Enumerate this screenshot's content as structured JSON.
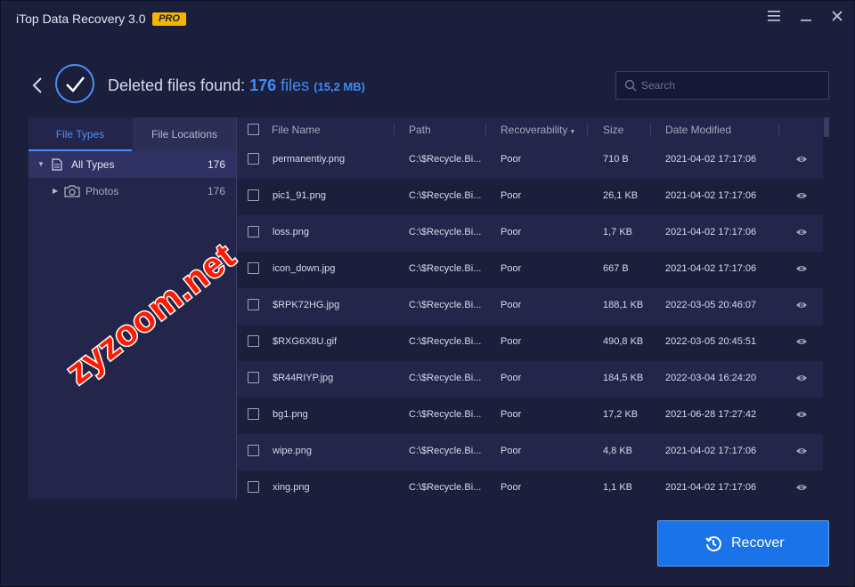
{
  "window": {
    "title": "iTop Data Recovery 3.0",
    "badge": "PRO",
    "menu_icon": "hamburger-menu-icon",
    "minimize_icon": "minimize-icon",
    "close_icon": "close-icon"
  },
  "header": {
    "prefix": "Deleted files found: ",
    "count": "176",
    "count_unit": " files",
    "size": "(15,2 MB)",
    "search_placeholder": "Search"
  },
  "sidebar": {
    "tabs": [
      {
        "label": "File Types",
        "active": true
      },
      {
        "label": "File Locations",
        "active": false
      }
    ],
    "tree": [
      {
        "label": "All Types",
        "count": "176",
        "icon": "document-icon",
        "selected": true
      },
      {
        "label": "Photos",
        "count": "176",
        "icon": "camera-icon",
        "selected": false
      }
    ]
  },
  "table": {
    "columns": [
      "File Name",
      "Path",
      "Recoverability",
      "Size",
      "Date Modified"
    ],
    "rows": [
      {
        "name": "permanentiy.png",
        "path": "C:\\$Recycle.Bi...",
        "recoverability": "Poor",
        "size": "710 B",
        "date": "2021-04-02 17:17:06"
      },
      {
        "name": "pic1_91.png",
        "path": "C:\\$Recycle.Bi...",
        "recoverability": "Poor",
        "size": "26,1 KB",
        "date": "2021-04-02 17:17:06"
      },
      {
        "name": "loss.png",
        "path": "C:\\$Recycle.Bi...",
        "recoverability": "Poor",
        "size": "1,7 KB",
        "date": "2021-04-02 17:17:06"
      },
      {
        "name": "icon_down.jpg",
        "path": "C:\\$Recycle.Bi...",
        "recoverability": "Poor",
        "size": "667 B",
        "date": "2021-04-02 17:17:06"
      },
      {
        "name": "$RPK72HG.jpg",
        "path": "C:\\$Recycle.Bi...",
        "recoverability": "Poor",
        "size": "188,1 KB",
        "date": "2022-03-05 20:46:07"
      },
      {
        "name": "$RXG6X8U.gif",
        "path": "C:\\$Recycle.Bi...",
        "recoverability": "Poor",
        "size": "490,8 KB",
        "date": "2022-03-05 20:45:51"
      },
      {
        "name": "$R44RIYP.jpg",
        "path": "C:\\$Recycle.Bi...",
        "recoverability": "Poor",
        "size": "184,5 KB",
        "date": "2022-03-04 16:24:20"
      },
      {
        "name": "bg1.png",
        "path": "C:\\$Recycle.Bi...",
        "recoverability": "Poor",
        "size": "17,2 KB",
        "date": "2021-06-28 17:27:42"
      },
      {
        "name": "wipe.png",
        "path": "C:\\$Recycle.Bi...",
        "recoverability": "Poor",
        "size": "4,8 KB",
        "date": "2021-04-02 17:17:06"
      },
      {
        "name": "xing.png",
        "path": "C:\\$Recycle.Bi...",
        "recoverability": "Poor",
        "size": "1,1 KB",
        "date": "2021-04-02 17:17:06"
      }
    ]
  },
  "footer": {
    "recover_label": "Recover"
  },
  "watermark": "zyzoom.net",
  "colors": {
    "background": "#1c1f3c",
    "panel": "#23264a",
    "accent": "#3c8cf8",
    "button": "#1a73e8",
    "badge": "#f5b400",
    "watermark": "#ff1a00"
  }
}
